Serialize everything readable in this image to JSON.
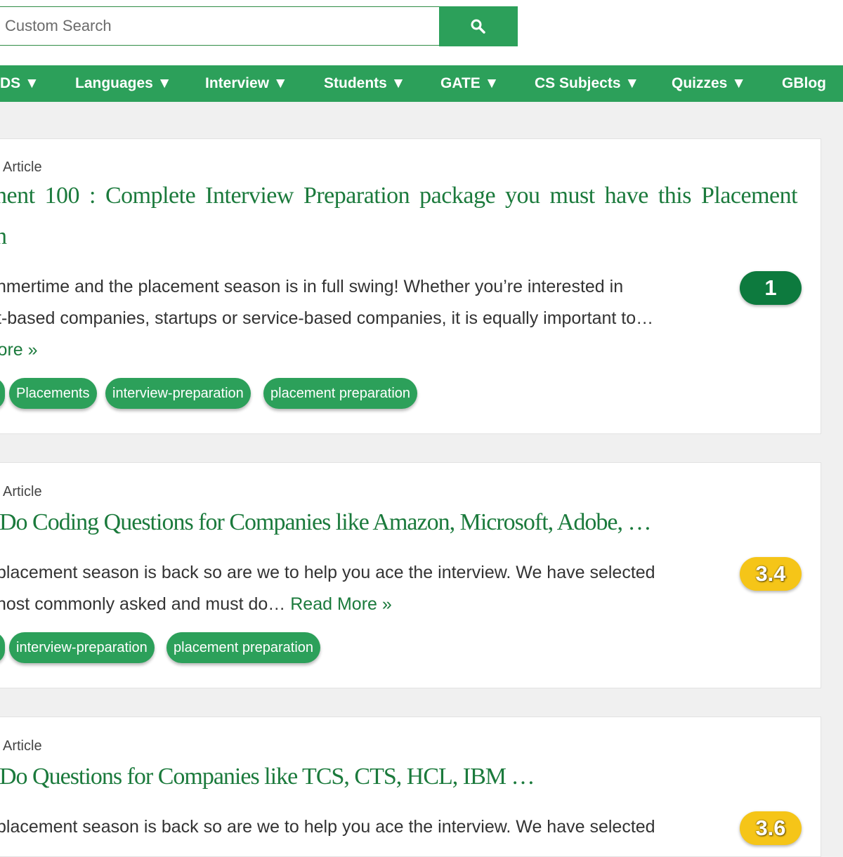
{
  "search": {
    "placeholder": "Custom Search"
  },
  "nav": {
    "items": [
      "DS ▼",
      "Languages ▼",
      "Interview ▼",
      "Students ▼",
      "GATE ▼",
      "CS Subjects ▼",
      "Quizzes ▼",
      "GBlog"
    ]
  },
  "articles": [
    {
      "type": "Article",
      "title_line1": "nent 100 : Complete Interview Preparation package you must have this Placement",
      "title_line2": "n",
      "excerpt_line1": "nmertime and the placement season is in full swing! Whether you’re interested in",
      "excerpt_line2": "t-based companies, startups or service-based companies, it is equally important to…",
      "read_more": "lore »",
      "rating": "1",
      "rating_color": "#0d7a3e",
      "tags": [
        "",
        "Placements",
        "interview-preparation",
        "placement preparation"
      ]
    },
    {
      "type": "Article",
      "title_line1": "Do Coding Questions for Companies like Amazon, Microsoft, Adobe, …",
      "excerpt_line1": "placement season is back so are we to help you ace the interview. We have selected",
      "excerpt_line2_prefix": "nost commonly asked and must do… ",
      "read_more": "Read More »",
      "rating": "3.4",
      "rating_color": "#f5c518",
      "tags": [
        "",
        "interview-preparation",
        "placement preparation"
      ]
    },
    {
      "type": "Article",
      "title_line1": "Do Questions for Companies like TCS, CTS, HCL, IBM …",
      "excerpt_line1": "placement season is back so are we to help you ace the interview. We have selected",
      "rating": "3.6",
      "rating_color": "#f5c518"
    }
  ]
}
